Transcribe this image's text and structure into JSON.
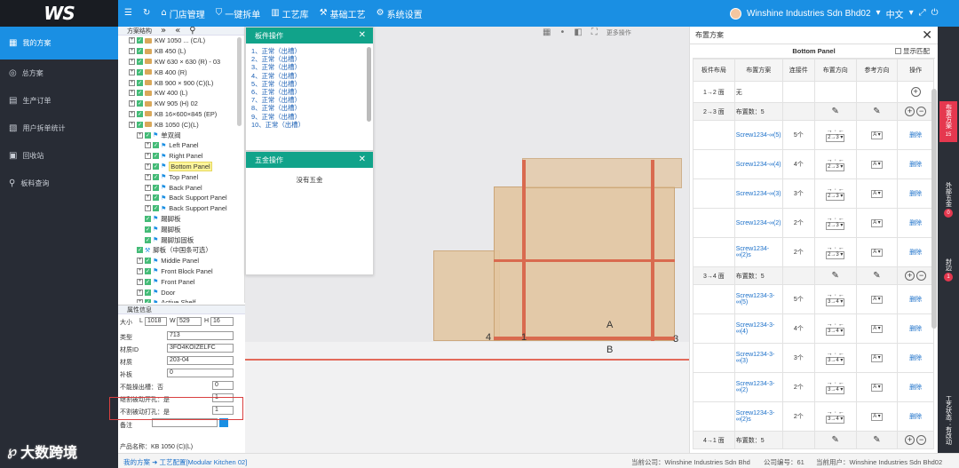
{
  "header": {
    "nav": [
      {
        "icon": "menu-icon",
        "label": ""
      },
      {
        "icon": "refresh-icon",
        "label": ""
      },
      {
        "icon": "store-icon",
        "label": "门店管理"
      },
      {
        "icon": "shield-icon",
        "label": "一键拆单"
      },
      {
        "icon": "library-icon",
        "label": "工艺库"
      },
      {
        "icon": "craft-icon",
        "label": "基础工艺"
      },
      {
        "icon": "gear-icon",
        "label": "系统设置"
      }
    ],
    "company": "Winshine Industries Sdn Bhd02",
    "language": "中文"
  },
  "sidebar": {
    "items": [
      {
        "label": "我的方案",
        "icon": "grid-icon",
        "active": true
      },
      {
        "label": "总方案",
        "icon": "compass-icon",
        "active": false
      },
      {
        "label": "生产订单",
        "icon": "order-icon",
        "active": false
      },
      {
        "label": "用户拆单统计",
        "icon": "chart-icon",
        "active": false
      },
      {
        "label": "回收站",
        "icon": "trash-icon",
        "active": false
      },
      {
        "label": "板料查询",
        "icon": "search-icon",
        "active": false
      }
    ]
  },
  "tree": {
    "header": "方案结构",
    "rows": [
      {
        "indent": 0,
        "label": "KW 1050 ... (C/L)",
        "type": "folder",
        "sel": false
      },
      {
        "indent": 0,
        "label": "KB 450 (L)",
        "type": "folder",
        "sel": false
      },
      {
        "indent": 0,
        "label": "KW 630 × 630 (R) - 03",
        "type": "folder",
        "sel": false
      },
      {
        "indent": 0,
        "label": "KB 400 (R)",
        "type": "folder",
        "sel": false
      },
      {
        "indent": 0,
        "label": "KB 900 × 900 (C)(L)",
        "type": "folder",
        "sel": false
      },
      {
        "indent": 0,
        "label": "KW 400 (L)",
        "type": "folder",
        "sel": false
      },
      {
        "indent": 0,
        "label": "KW 905 (H) 02",
        "type": "folder",
        "sel": false
      },
      {
        "indent": 0,
        "label": "KB 16×600×845 (EP)",
        "type": "folder",
        "sel": false
      },
      {
        "indent": 0,
        "label": "KB 1050 (C)(L)",
        "type": "folder",
        "sel": false
      },
      {
        "indent": 1,
        "label": "单双阀",
        "type": "flag",
        "sel": false
      },
      {
        "indent": 2,
        "label": "Left Panel",
        "type": "flag",
        "sel": false
      },
      {
        "indent": 2,
        "label": "Right Panel",
        "type": "flag",
        "sel": false
      },
      {
        "indent": 2,
        "label": "Bottom Panel",
        "type": "flag",
        "sel": true
      },
      {
        "indent": 2,
        "label": "Top Panel",
        "type": "flag",
        "sel": false
      },
      {
        "indent": 2,
        "label": "Back Panel",
        "type": "flag",
        "sel": false
      },
      {
        "indent": 2,
        "label": "Back Support Panel",
        "type": "flag",
        "sel": false
      },
      {
        "indent": 2,
        "label": "Back Support Panel",
        "type": "flag",
        "sel": false
      },
      {
        "indent": 2,
        "label": "踢脚板",
        "type": "flag",
        "sel": false
      },
      {
        "indent": 2,
        "label": "踢脚板",
        "type": "flag",
        "sel": false
      },
      {
        "indent": 2,
        "label": "踢脚加固板",
        "type": "flag",
        "sel": false
      },
      {
        "indent": 1,
        "label": "脚板（中国条可选）",
        "type": "tool",
        "sel": false
      },
      {
        "indent": 1,
        "label": "Middle Panel",
        "type": "flag",
        "sel": false
      },
      {
        "indent": 1,
        "label": "Front Block Panel",
        "type": "flag",
        "sel": false
      },
      {
        "indent": 1,
        "label": "Front Panel",
        "type": "flag",
        "sel": false
      },
      {
        "indent": 1,
        "label": "Door",
        "type": "flag",
        "sel": false
      },
      {
        "indent": 1,
        "label": "Active Shelf",
        "type": "flag",
        "sel": false
      }
    ]
  },
  "props": {
    "header": "属性信息",
    "size_label": "大小",
    "L": "1018",
    "W": "529",
    "H": "16",
    "type_label": "类型",
    "type_value": "713",
    "material_label": "材质ID",
    "material_value": "3FO4KOIZELFC",
    "color_label": "材质",
    "color_value": "203-04",
    "edge_label": "补板",
    "edge_value": "0",
    "opt1_label": "不能操出槽：否",
    "opt1_value": "0",
    "opt2_label": "继割被动开孔：是",
    "opt2_value": "1",
    "opt3_label": "不割被动打孔：是",
    "opt3_value": "1",
    "note_label": "备注",
    "product_label": "产品名称：KB 1050 (C)(L)"
  },
  "panel_ops": {
    "title": "板件操作",
    "rows": [
      "1、正常（出槽）",
      "2、正常（出槽）",
      "3、正常（出槽）",
      "4、正常（出槽）",
      "5、正常（出槽）",
      "6、正常（出槽）",
      "7、正常（出槽）",
      "8、正常（出槽）",
      "9、正常（出槽）",
      "10、正常（出槽）"
    ]
  },
  "hardware_ops": {
    "title": "五金操作",
    "empty": "没有五金"
  },
  "viewport": {
    "labels": [
      "A",
      "B",
      "4",
      "1",
      "3"
    ],
    "toolbar_text": "更多操作"
  },
  "layout_panel": {
    "title": "布置方案",
    "panel_name": "Bottom Panel",
    "show_match": "显示匹配",
    "columns": [
      "板件布局",
      "布置方案",
      "连接件",
      "布置方向",
      "参考方向",
      "操作"
    ],
    "first_row": {
      "face": "1→2 面",
      "scheme": "无"
    },
    "groups": [
      {
        "face": "2→3 面",
        "count": "布置数：5",
        "dir_default": "2→3",
        "rows": [
          {
            "scheme": "Screw1234-∞(5)",
            "count": "5个",
            "dir": "2→3",
            "ref": "A",
            "op": "删除"
          },
          {
            "scheme": "Screw1234-∞(4)",
            "count": "4个",
            "dir": "2→3",
            "ref": "A",
            "op": "删除"
          },
          {
            "scheme": "Screw1234-∞(3)",
            "count": "3个",
            "dir": "2→3",
            "ref": "A",
            "op": "删除"
          },
          {
            "scheme": "Screw1234-∞(2)",
            "count": "2个",
            "dir": "2→3",
            "ref": "A",
            "op": "删除"
          },
          {
            "scheme": "Screw1234-∞(2)s",
            "count": "2个",
            "dir": "2→3",
            "ref": "A",
            "op": "删除"
          }
        ]
      },
      {
        "face": "3→4 面",
        "count": "布置数：5",
        "dir_default": "3→4",
        "rows": [
          {
            "scheme": "Screw1234-3-∞(5)",
            "count": "5个",
            "dir": "3→4",
            "ref": "A",
            "op": "删除"
          },
          {
            "scheme": "Screw1234-3-∞(4)",
            "count": "4个",
            "dir": "3→4",
            "ref": "A",
            "op": "删除"
          },
          {
            "scheme": "Screw1234-3-∞(3)",
            "count": "3个",
            "dir": "3→4",
            "ref": "A",
            "op": "删除"
          },
          {
            "scheme": "Screw1234-3-∞(2)",
            "count": "2个",
            "dir": "3→4",
            "ref": "A",
            "op": "删除"
          },
          {
            "scheme": "Screw1234-3-∞(2)s",
            "count": "2个",
            "dir": "3→4",
            "ref": "A",
            "op": "删除"
          }
        ]
      },
      {
        "face": "4→1 面",
        "count": "布置数：5",
        "dir_default": "",
        "rows": []
      }
    ]
  },
  "right_tabs": [
    {
      "label": "布置方案",
      "badge": "15",
      "active": true
    },
    {
      "label": "外部五金",
      "badge": "0",
      "active": false
    },
    {
      "label": "封边",
      "badge": "1",
      "active": false
    },
    {
      "label": "工艺状态：有改动",
      "badge": "",
      "active": false
    }
  ],
  "status": {
    "breadcrumb": "我的方案 ➜ 工艺配置[Modular Kitchen 02]",
    "company": "当前公司：Winshine Industries Sdn Bhd",
    "company_id": "公司编号：61",
    "user": "当前用户：Winshine Industries Sdn Bhd02"
  },
  "watermark": "大数跨境"
}
